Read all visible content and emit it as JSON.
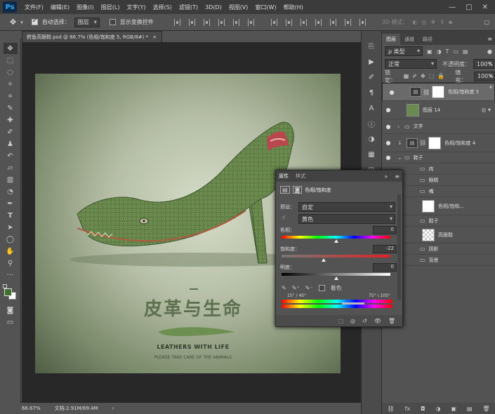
{
  "app": {
    "logo": "Ps"
  },
  "menubar": {
    "items": [
      "文件(F)",
      "编辑(E)",
      "图像(I)",
      "图层(L)",
      "文字(Y)",
      "选择(S)",
      "滤镜(T)",
      "3D(D)",
      "视图(V)",
      "窗口(W)",
      "帮助(H)"
    ],
    "window_controls": [
      "—",
      "□",
      "✕"
    ]
  },
  "options": {
    "auto_select_label": "自动选择：",
    "auto_select_value": "图层",
    "show_transform_label": "显示变换控件",
    "mode_3d": "3D 模式："
  },
  "document": {
    "tab_title": "鳄鱼高跟鞋.psd @ 66.7% (色相/饱和度 5, RGB/8#) *",
    "zoom": "66.67%",
    "doc_size": "文档:2.91M/69.4M"
  },
  "artwork": {
    "title": "皮革与生命",
    "line1": "LEATHERS WITH LIFE",
    "line2": "PLEASE TAKE CARE OF THE ANIMALS"
  },
  "layers_panel": {
    "tabs": [
      "图层",
      "通道",
      "路径"
    ],
    "kind_label": "ρ 类型",
    "blend_mode": "正常",
    "opacity_label": "不透明度：",
    "opacity": "100%",
    "lock_label": "锁定：",
    "fill_label": "填充：",
    "fill": "100%",
    "layers": [
      {
        "name": "色相/饱和度 5",
        "type": "adj",
        "visible": "●",
        "selected": true
      },
      {
        "name": "图层 14",
        "type": "shoe",
        "visible": "●",
        "selected": false
      },
      {
        "name": "文字",
        "type": "group",
        "visible": "●",
        "selected": false
      },
      {
        "name": "色相/饱和度 4",
        "type": "adj",
        "visible": "●",
        "selected": false
      },
      {
        "name": "鞋子",
        "type": "group",
        "visible": "●",
        "selected": false
      },
      {
        "name": "肉",
        "type": "group",
        "visible": "",
        "selected": false
      },
      {
        "name": "眼睛",
        "type": "group",
        "visible": "",
        "selected": false
      },
      {
        "name": "嘴",
        "type": "group",
        "visible": "",
        "selected": false
      },
      {
        "name": "色相/饱和...",
        "type": "adj",
        "visible": "",
        "selected": false
      },
      {
        "name": "鞋子",
        "type": "group",
        "visible": "",
        "selected": false
      },
      {
        "name": "高跟鞋",
        "type": "img",
        "visible": "",
        "selected": false
      },
      {
        "name": "阴影",
        "type": "group",
        "visible": "",
        "selected": false
      },
      {
        "name": "背景",
        "type": "group",
        "visible": "",
        "selected": false
      }
    ],
    "footer": [
      "⛓",
      "fx",
      "◘",
      "◑",
      "▣",
      "▤",
      "🗑"
    ]
  },
  "properties_panel": {
    "tabs": [
      "属性",
      "样式"
    ],
    "adjustment_name": "色相/饱和度",
    "preset_label": "预设：",
    "preset_value": "自定",
    "channel_value": "黄色",
    "hue_label": "色相：",
    "hue": "0",
    "saturation_label": "饱和度：",
    "saturation": "-22",
    "lightness_label": "明度：",
    "lightness": "0",
    "colorize_label": "着色",
    "range_left": "15° / 45°",
    "range_right": "75° \\ 105°",
    "footer": [
      "⬚",
      "◎",
      "↺",
      "👁",
      "🗑"
    ]
  },
  "colors": {
    "accent": "#31a8ff",
    "foreground": "#3f6f2c",
    "background": "#ffffff"
  },
  "slider_levels": {
    "hue": 0.5,
    "saturation": 0.39,
    "lightness": 0.5
  }
}
